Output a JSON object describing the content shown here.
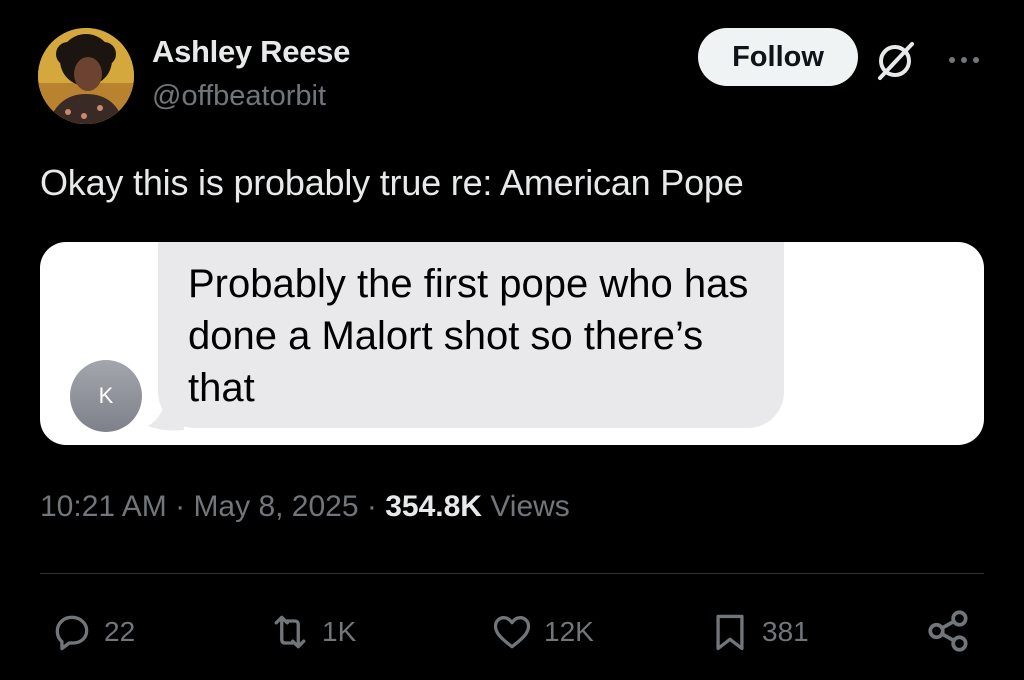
{
  "author": {
    "name": "Ashley Reese",
    "handle": "@offbeatorbit"
  },
  "header": {
    "follow_label": "Follow",
    "grok_icon": "grok-icon",
    "more_icon": "more-icon"
  },
  "tweet": {
    "text": "Okay this is probably true re: American Pope"
  },
  "embedded_image": {
    "sender_initial": "K",
    "message": "Probably the first pope who has done a Malort shot so there’s that",
    "bubble_color": "#e9e9eb"
  },
  "meta": {
    "time": "10:21 AM",
    "date": "May 8, 2025",
    "views_count": "354.8K",
    "views_label": "Views"
  },
  "actions": {
    "replies": "22",
    "reposts": "1K",
    "likes": "12K",
    "bookmarks": "381"
  },
  "colors": {
    "background": "#000000",
    "primary_text": "#e7e9ea",
    "secondary_text": "#71767b",
    "divider": "#2f3336"
  }
}
